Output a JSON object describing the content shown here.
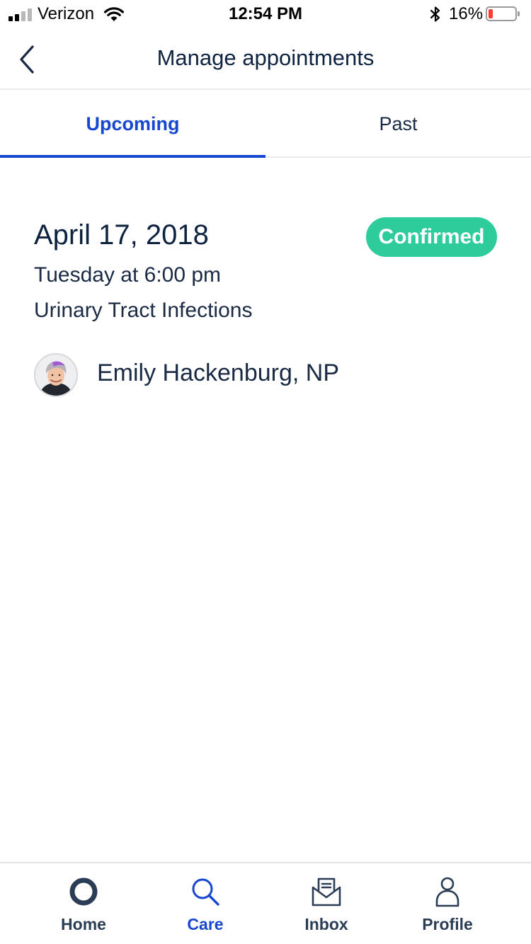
{
  "status_bar": {
    "carrier": "Verizon",
    "time": "12:54 PM",
    "battery_percent": "16%",
    "battery_level": 0.16,
    "signal_bars_filled": 2,
    "signal_bars_total": 4,
    "icons": [
      "signal-icon",
      "wifi-icon",
      "bluetooth-icon",
      "battery-icon"
    ]
  },
  "header": {
    "title": "Manage appointments",
    "back_icon": "chevron-left-icon"
  },
  "tabs": [
    {
      "label": "Upcoming",
      "active": true
    },
    {
      "label": "Past",
      "active": false
    }
  ],
  "appointment": {
    "date": "April 17, 2018",
    "status": "Confirmed",
    "day_time": "Tuesday at 6:00 pm",
    "reason": "Urinary Tract Infections",
    "provider": "Emily Hackenburg, NP"
  },
  "bottom_nav": [
    {
      "label": "Home",
      "icon": "home-ring-icon",
      "active": false
    },
    {
      "label": "Care",
      "icon": "search-icon",
      "active": true
    },
    {
      "label": "Inbox",
      "icon": "inbox-icon",
      "active": false
    },
    {
      "label": "Profile",
      "icon": "person-icon",
      "active": false
    }
  ],
  "colors": {
    "accent": "#1746d1",
    "status_confirmed": "#2ecc9a",
    "text_primary": "#0d2340",
    "nav_inactive": "#2b3c55",
    "battery_low": "#ff3b30"
  }
}
